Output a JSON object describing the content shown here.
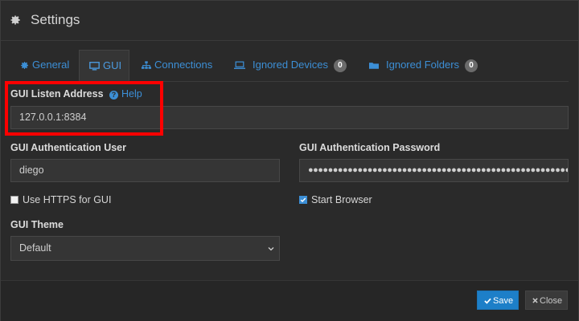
{
  "dialog": {
    "title": "Settings"
  },
  "tabs": [
    {
      "label": "General"
    },
    {
      "label": "GUI",
      "active": true
    },
    {
      "label": "Connections"
    },
    {
      "label": "Ignored Devices",
      "badge": "0"
    },
    {
      "label": "Ignored Folders",
      "badge": "0"
    }
  ],
  "gui": {
    "listen_address_label": "GUI Listen Address",
    "help_label": "Help",
    "listen_address_value": "127.0.0.1:8384",
    "auth_user_label": "GUI Authentication User",
    "auth_user_value": "diego",
    "auth_password_label": "GUI Authentication Password",
    "auth_password_value": "●●●●●●●●●●●●●●●●●●●●●●●●●●●●●●●●●●●●●●●●●●●●●●●●●●●●●●●●●●●●",
    "https_label": "Use HTTPS for GUI",
    "https_checked": false,
    "start_browser_label": "Start Browser",
    "start_browser_checked": true,
    "theme_label": "GUI Theme",
    "theme_value": "Default"
  },
  "footer": {
    "save_label": "Save",
    "close_label": "Close"
  },
  "colors": {
    "accent": "#3c8fd6",
    "save_bg": "#1d7fc8",
    "highlight": "#ff0000"
  }
}
